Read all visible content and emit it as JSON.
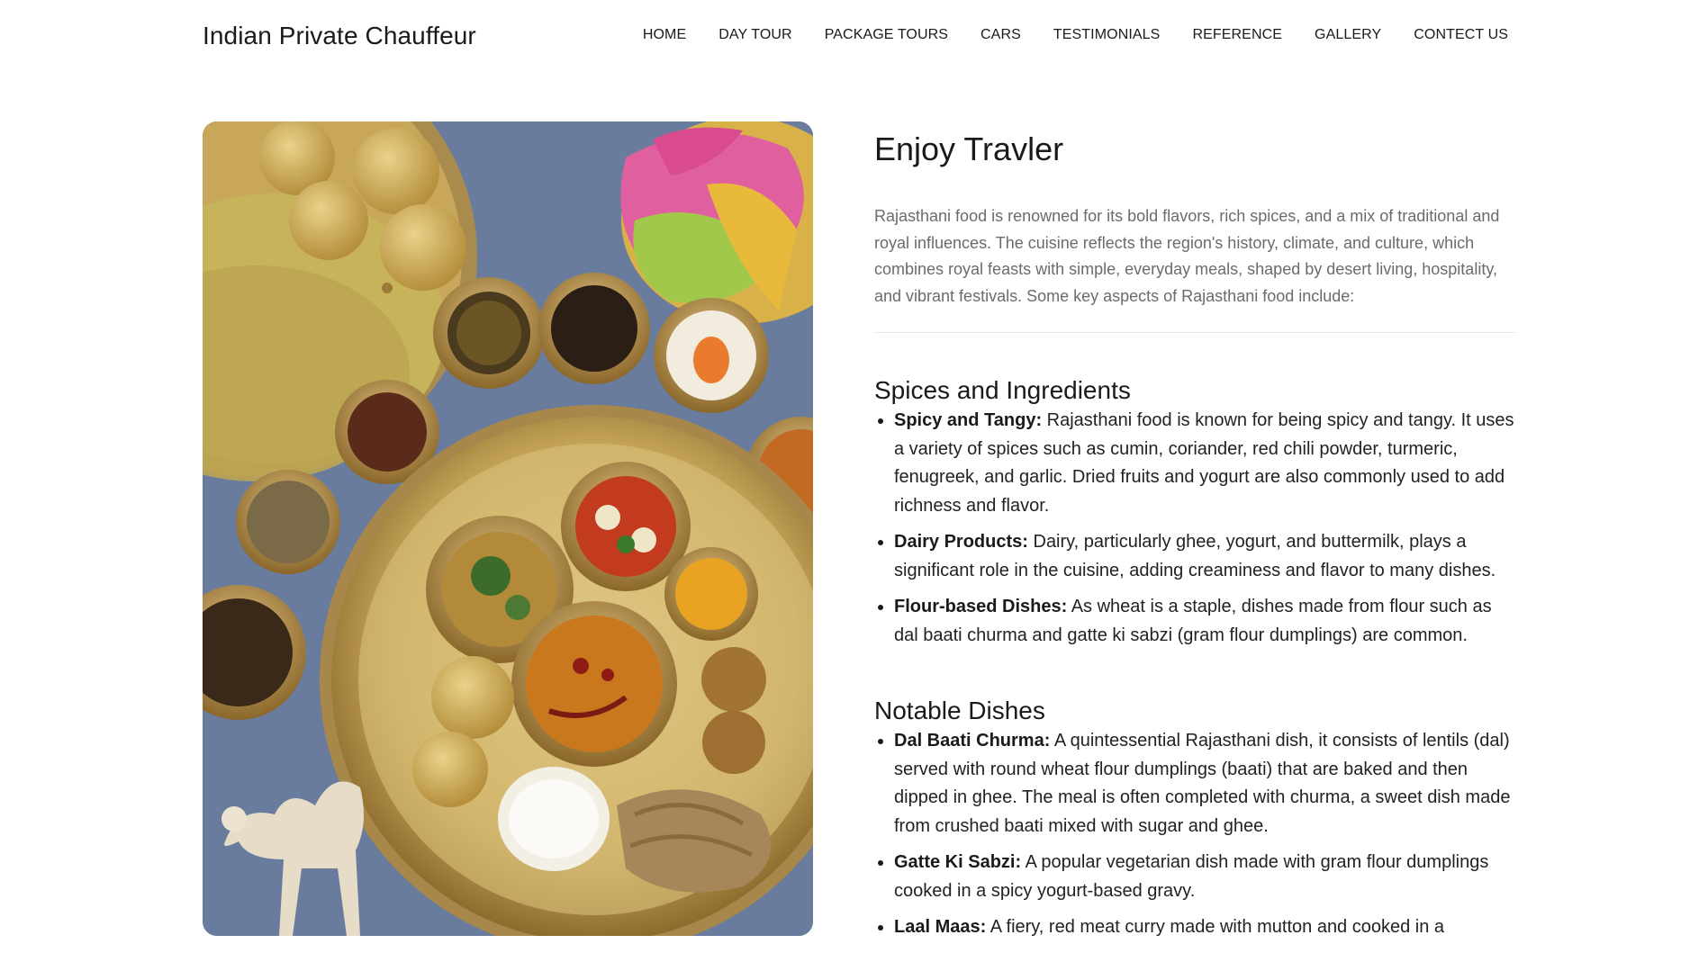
{
  "header": {
    "brand": "Indian Private Chauffeur",
    "nav": [
      "HOME",
      "DAY TOUR",
      "PACKAGE TOURS",
      "CARS",
      "TESTIMONIALS",
      "REFERENCE",
      "GALLERY",
      "CONTECT US"
    ]
  },
  "main": {
    "title": "Enjoy Travler",
    "intro": "Rajasthani food is renowned for its bold flavors, rich spices, and a mix of traditional and royal influences. The cuisine reflects the region's history, climate, and culture, which combines royal feasts with simple, everyday meals, shaped by desert living, hospitality, and vibrant festivals. Some key aspects of Rajasthani food include:",
    "sections": [
      {
        "heading": "Spices and Ingredients",
        "items": [
          {
            "term": "Spicy and Tangy:",
            "text": " Rajasthani food is known for being spicy and tangy. It uses a variety of spices such as cumin, coriander, red chili powder, turmeric, fenugreek, and garlic. Dried fruits and yogurt are also commonly used to add richness and flavor."
          },
          {
            "term": "Dairy Products:",
            "text": " Dairy, particularly ghee, yogurt, and buttermilk, plays a significant role in the cuisine, adding creaminess and flavor to many dishes."
          },
          {
            "term": "Flour-based Dishes:",
            "text": " As wheat is a staple, dishes made from flour such as dal baati churma and gatte ki sabzi (gram flour dumplings) are common."
          }
        ]
      },
      {
        "heading": "Notable Dishes",
        "items": [
          {
            "term": "Dal Baati Churma:",
            "text": " A quintessential Rajasthani dish, it consists of lentils (dal) served with round wheat flour dumplings (baati) that are baked and then dipped in ghee. The meal is often completed with churma, a sweet dish made from crushed baati mixed with sugar and ghee."
          },
          {
            "term": "Gatte Ki Sabzi:",
            "text": " A popular vegetarian dish made with gram flour dumplings cooked in a spicy yogurt-based gravy."
          },
          {
            "term": "Laal Maas:",
            "text": " A fiery, red meat curry made with mutton and cooked in a"
          }
        ]
      }
    ]
  },
  "colors": {
    "text": "#1a1a1a",
    "muted": "#6b6b6b",
    "photo_background": "#6f83a3",
    "brass": "#c9a85c"
  },
  "image": {
    "icon": "rajasthani-thali-photo"
  }
}
